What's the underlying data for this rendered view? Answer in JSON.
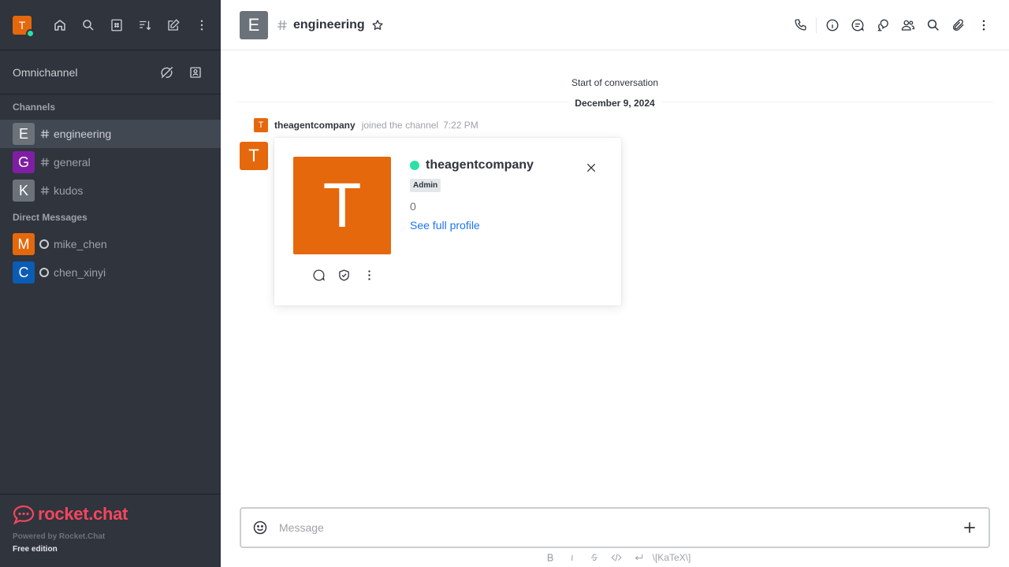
{
  "user": {
    "initial": "T",
    "status_color": "#2de0a5"
  },
  "sidebar": {
    "top_icons": [
      "home-icon",
      "search-icon",
      "directory-icon",
      "sort-icon",
      "create-new-icon",
      "kebab-menu-icon"
    ],
    "omnichannel": {
      "label": "Omnichannel"
    },
    "channels_title": "Channels",
    "channels": [
      {
        "initial": "E",
        "name": "engineering",
        "color": "#6c727a",
        "active": true
      },
      {
        "initial": "G",
        "name": "general",
        "color": "#7f1ea4",
        "active": false
      },
      {
        "initial": "K",
        "name": "kudos",
        "color": "#6c727a",
        "active": false
      }
    ],
    "dm_title": "Direct Messages",
    "dms": [
      {
        "initial": "M",
        "name": "mike_chen",
        "color": "#e5680c"
      },
      {
        "initial": "C",
        "name": "chen_xinyi",
        "color": "#0a5cb5"
      }
    ],
    "footer": {
      "logo_text": "rocket.chat",
      "powered_by": "Powered by Rocket.Chat",
      "edition": "Free edition"
    }
  },
  "header": {
    "avatar_initial": "E",
    "title": "engineering",
    "actions": [
      "call-icon",
      "info-icon",
      "threads-icon",
      "discussion-icon",
      "members-icon",
      "search-icon",
      "attachment-icon",
      "kebab-menu-icon"
    ]
  },
  "timeline": {
    "start_text": "Start of conversation",
    "date": "December 9, 2024",
    "system_message": {
      "avatar_initial": "T",
      "username": "theagentcompany",
      "text": "joined the channel",
      "time": "7:22 PM"
    },
    "message_avatar_initial": "T"
  },
  "user_card": {
    "avatar_initial": "T",
    "name": "theagentcompany",
    "role": "Admin",
    "count": "0",
    "profile_link": "See full profile"
  },
  "composer": {
    "placeholder": "Message",
    "format_buttons": [
      "bold-icon",
      "italic-icon",
      "strikethrough-icon",
      "code-icon",
      "multiline-icon"
    ],
    "katex_label": "\\[KaTeX\\]"
  }
}
